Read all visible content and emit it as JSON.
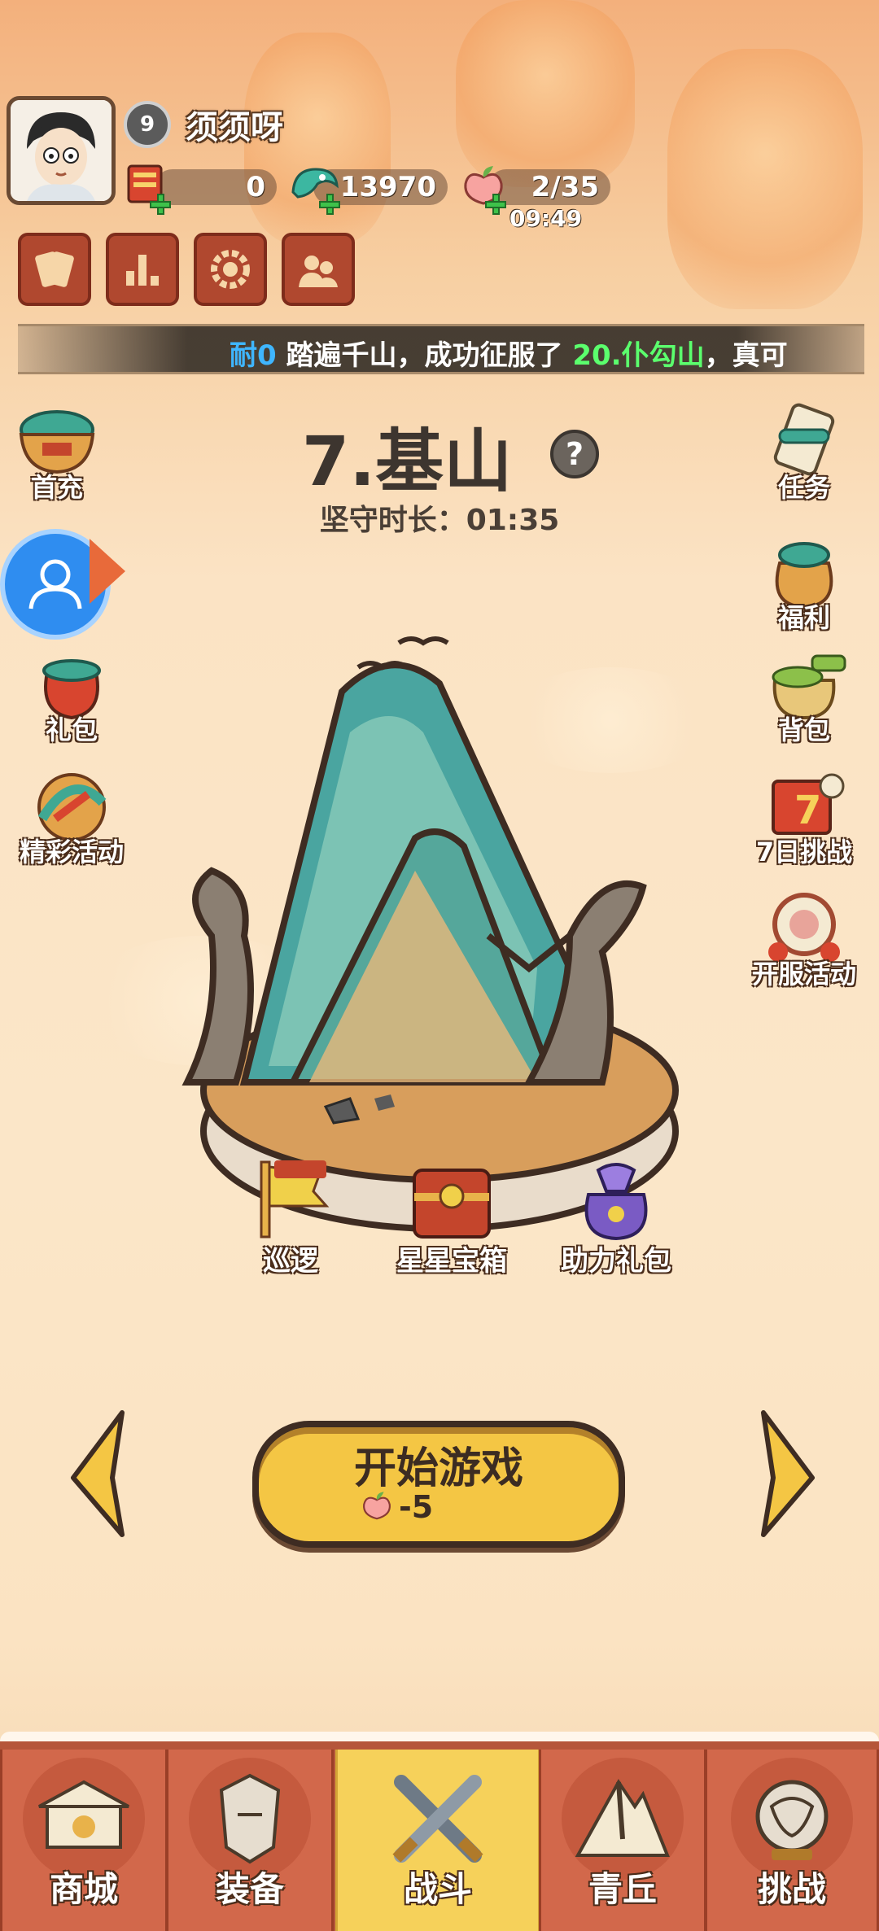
{
  "player": {
    "level": "9",
    "name": "须须呀"
  },
  "resources": {
    "tickets": "0",
    "jade": "13970",
    "stamina": "2/35",
    "stamina_timer": "09:49"
  },
  "marquee": {
    "part1": "耐0",
    "part2": " 踏遍千山，成功征服了 ",
    "part3": "20.仆勾山",
    "part4": "，真可"
  },
  "stage": {
    "title": "7.基山",
    "help": "?",
    "hold_time": "坚守时长：01:35"
  },
  "left_menu": [
    "首充",
    "礼包",
    "精彩活动"
  ],
  "right_menu": [
    "任务",
    "福利",
    "背包",
    "7日挑战",
    "开服活动"
  ],
  "island_items": [
    "巡逻",
    "星星宝箱",
    "助力礼包"
  ],
  "start": {
    "label": "开始游戏",
    "cost": "-5"
  },
  "tabs": [
    "商城",
    "装备",
    "战斗",
    "青丘",
    "挑战"
  ],
  "active_tab": "战斗",
  "colors": {
    "accent_yellow": "#f6d15a",
    "tab_red": "#d2684b",
    "marquee_blue": "#3fb6ff",
    "marquee_green": "#5bff6d"
  }
}
